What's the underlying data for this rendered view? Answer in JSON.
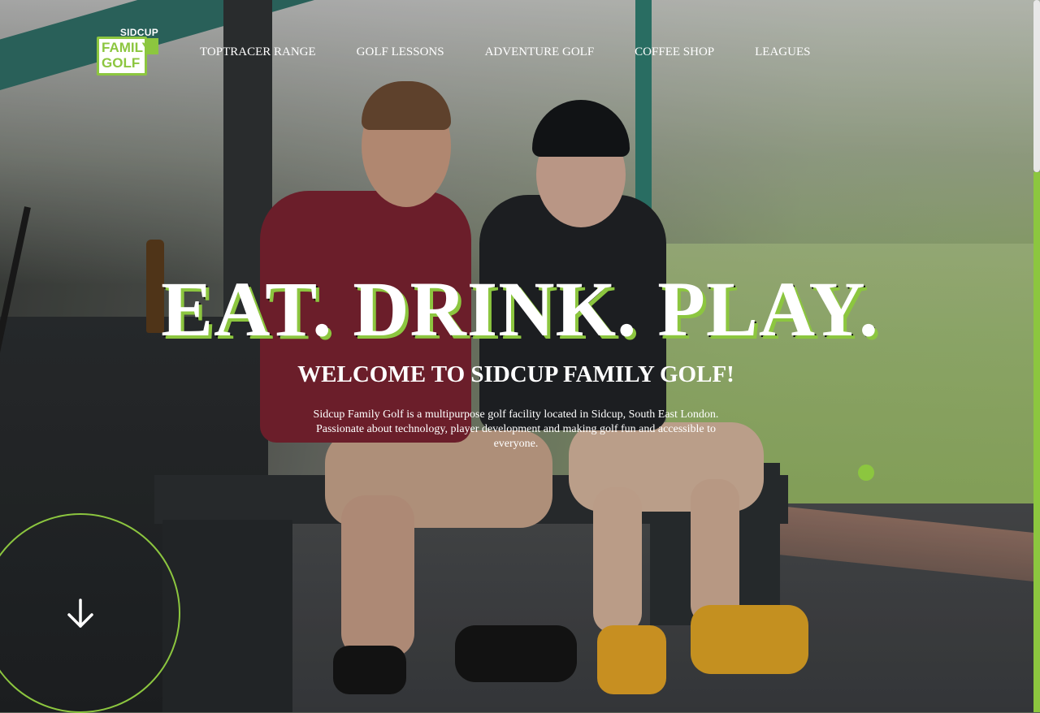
{
  "brand": {
    "logo_top": "SIDCUP",
    "logo_line1": "FAMILY",
    "logo_line2": "GOLF",
    "accent_color": "#8cc63f"
  },
  "nav": {
    "items": [
      {
        "label": "TOPTRACER RANGE"
      },
      {
        "label": "GOLF LESSONS"
      },
      {
        "label": "ADVENTURE GOLF"
      },
      {
        "label": "COFFEE SHOP"
      },
      {
        "label": "LEAGUES"
      }
    ]
  },
  "hero": {
    "headline": "EAT. DRINK. PLAY.",
    "subheading": "WELCOME TO SIDCUP FAMILY GOLF!",
    "intro": "Sidcup Family Golf is a multipurpose golf facility located in Sidcup, South East London. Passionate about technology, player development and making golf fun and accessible to everyone.",
    "scroll_icon": "arrow-down-icon"
  }
}
